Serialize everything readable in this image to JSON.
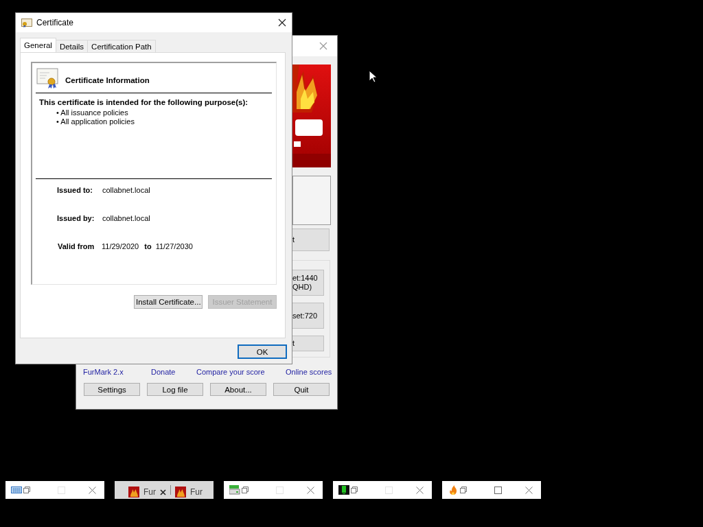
{
  "background_window": {
    "banner": {
      "kind": "picture"
    },
    "button_partial": {
      "lines": [
        "t"
      ]
    },
    "group_buttons": [
      {
        "lines": [
          "et:1440",
          "QHD)"
        ]
      },
      {
        "lines": [
          "set:720"
        ]
      },
      {
        "lines": [
          "t"
        ]
      }
    ],
    "links": [
      "FurMark 2.x",
      "Donate",
      "Compare your score",
      "Online scores"
    ],
    "buttons": [
      "Settings",
      "Log file",
      "About...",
      "Quit"
    ]
  },
  "certificate_window": {
    "title": "Certificate",
    "tabs": [
      {
        "label": "General",
        "selected": true
      },
      {
        "label": "Details",
        "selected": false
      },
      {
        "label": "Certification Path",
        "selected": false
      }
    ],
    "heading": "Certificate Information",
    "purpose_heading": "This certificate is intended for the following purpose(s):",
    "purposes": [
      "All issuance policies",
      "All application policies"
    ],
    "bullet": "•",
    "issued_to": {
      "label": "Issued to:",
      "value": "collabnet.local"
    },
    "issued_by": {
      "label": "Issued by:",
      "value": "collabnet.local"
    },
    "validity": {
      "label": "Valid from",
      "from": "11/29/2020",
      "to_label": "to",
      "to": "11/27/2030"
    },
    "buttons": [
      {
        "label": "Install Certificate...",
        "disabled": false
      },
      {
        "label": "Issuer Statement",
        "disabled": true
      }
    ],
    "ok_button": {
      "label": "OK",
      "focused": true
    }
  },
  "thumbnails": [
    {
      "kind": "window",
      "maximize_disabled": true
    },
    {
      "kind": "tabs",
      "tabs": [
        "Fur",
        "Fur"
      ]
    },
    {
      "kind": "window",
      "maximize_disabled": true
    },
    {
      "kind": "window",
      "maximize_disabled": true
    },
    {
      "kind": "window",
      "maximize_disabled": false
    }
  ]
}
